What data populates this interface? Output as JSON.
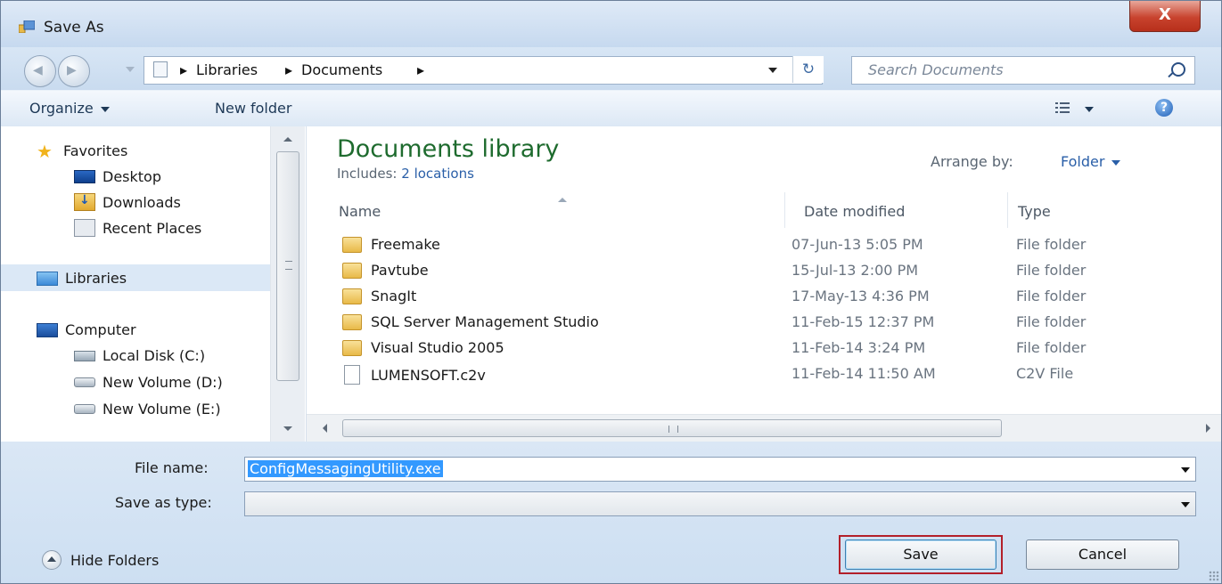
{
  "window": {
    "title": "Save As",
    "close_label": "X"
  },
  "address": {
    "crumbs": [
      "Libraries",
      "Documents"
    ],
    "separator": "▸",
    "search_placeholder": "Search Documents"
  },
  "toolbar": {
    "organize": "Organize",
    "new_folder": "New folder",
    "help": "?"
  },
  "nav": {
    "items": [
      {
        "label": "Favorites",
        "icon": "star-icon"
      },
      {
        "label": "Desktop",
        "icon": "desktop-icon"
      },
      {
        "label": "Downloads",
        "icon": "downloads-icon"
      },
      {
        "label": "Recent Places",
        "icon": "recent-places-icon"
      },
      {
        "label": "Libraries",
        "icon": "libraries-icon",
        "selected": true
      },
      {
        "label": "Computer",
        "icon": "computer-icon"
      },
      {
        "label": "Local Disk (C:)",
        "icon": "local-disk-icon"
      },
      {
        "label": "New Volume (D:)",
        "icon": "drive-icon"
      },
      {
        "label": "New Volume (E:)",
        "icon": "drive-icon"
      }
    ]
  },
  "library": {
    "title": "Documents library",
    "includes_label": "Includes:",
    "includes_link": "2 locations",
    "arrange_label": "Arrange by:",
    "arrange_value": "Folder"
  },
  "columns": {
    "name": "Name",
    "date": "Date modified",
    "type": "Type"
  },
  "files": [
    {
      "name": "Freemake",
      "date": "07-Jun-13 5:05 PM",
      "type": "File folder",
      "kind": "folder"
    },
    {
      "name": "Pavtube",
      "date": "15-Jul-13 2:00 PM",
      "type": "File folder",
      "kind": "folder"
    },
    {
      "name": "SnagIt",
      "date": "17-May-13 4:36 PM",
      "type": "File folder",
      "kind": "folder"
    },
    {
      "name": "SQL Server Management Studio",
      "date": "11-Feb-15 12:37 PM",
      "type": "File folder",
      "kind": "folder"
    },
    {
      "name": "Visual Studio 2005",
      "date": "11-Feb-14 3:24 PM",
      "type": "File folder",
      "kind": "folder"
    },
    {
      "name": "LUMENSOFT.c2v",
      "date": "11-Feb-14 11:50 AM",
      "type": "C2V File",
      "kind": "file"
    }
  ],
  "form": {
    "file_name_label": "File name:",
    "file_name_value": "ConfigMessagingUtility.exe",
    "save_type_label": "Save as type:",
    "save_type_value": ""
  },
  "buttons": {
    "hide_folders": "Hide Folders",
    "save": "Save",
    "cancel": "Cancel"
  },
  "colors": {
    "library_title": "#1e6b2e",
    "link": "#2a5fa8",
    "selection": "#3399ff",
    "save_highlight": "#b3202a"
  }
}
